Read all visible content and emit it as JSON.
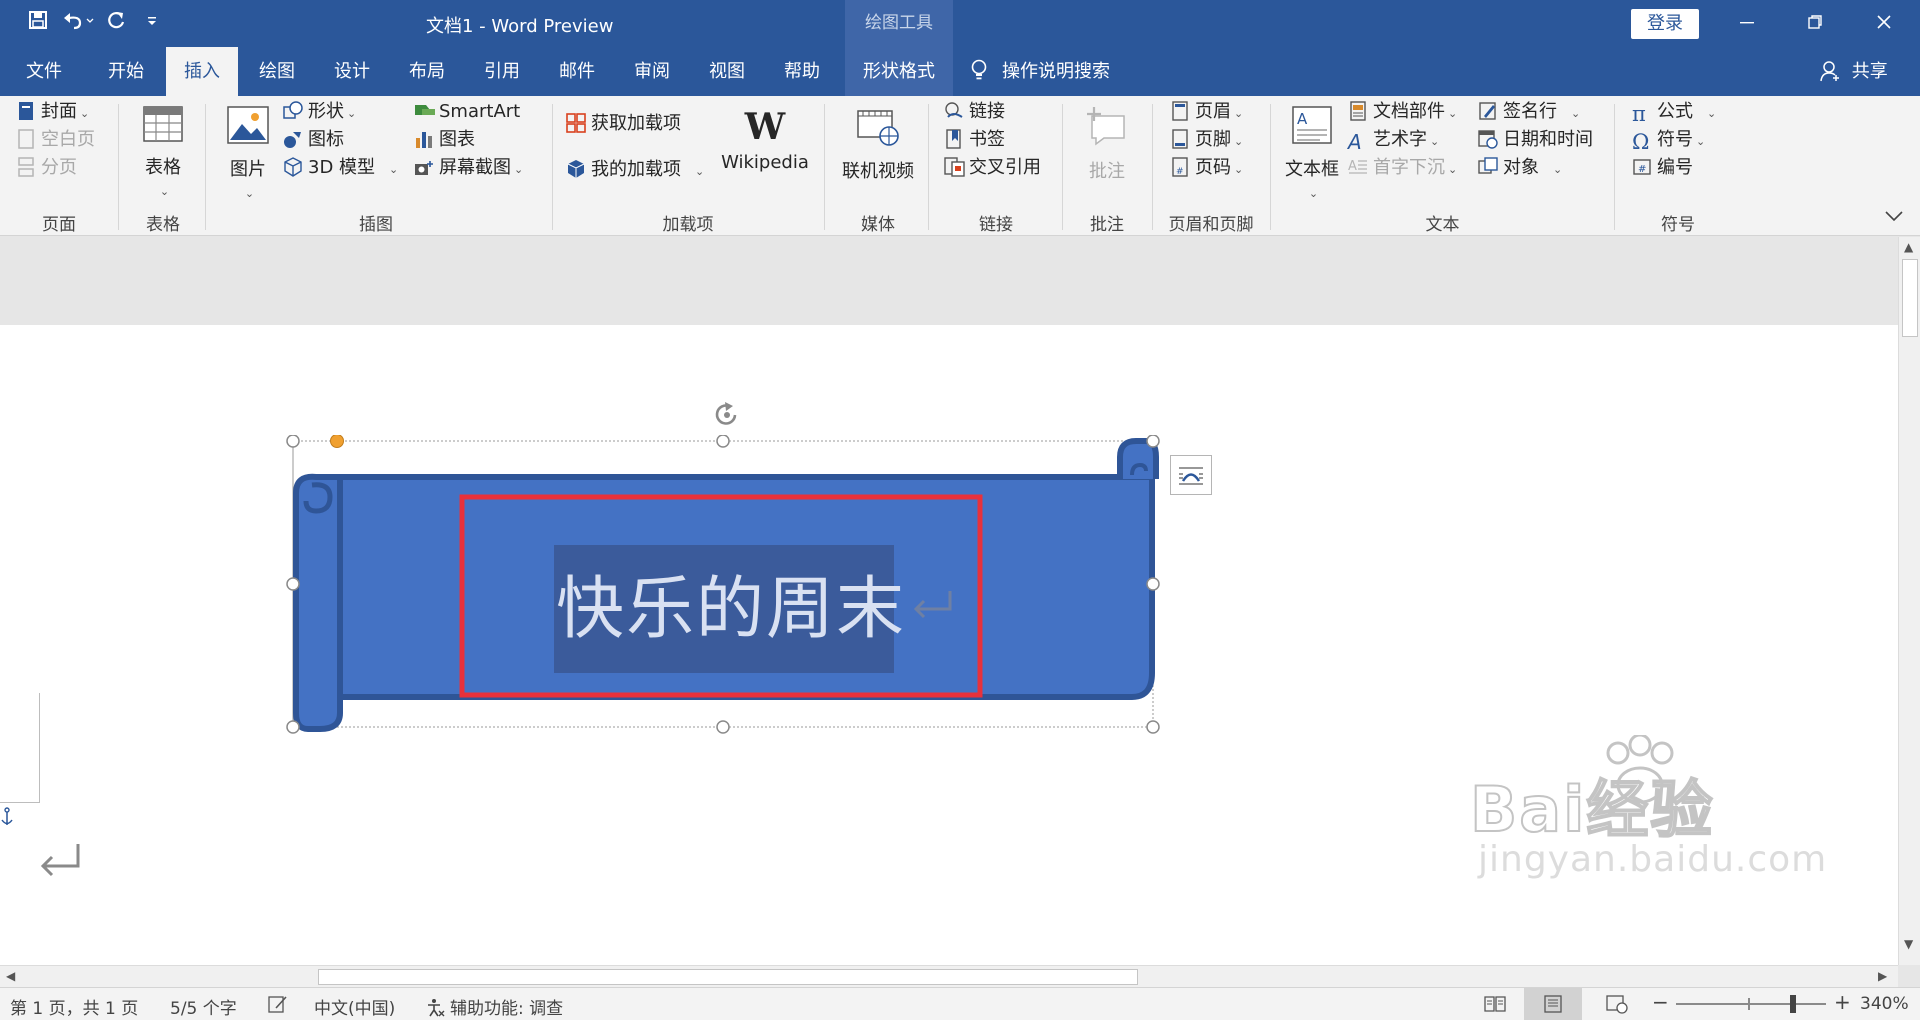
{
  "titlebar": {
    "document_title": "文档1  -  Word Preview",
    "context_tool": "绘图工具",
    "login": "登录",
    "save_icon": "save-icon",
    "undo_icon": "undo-icon",
    "redo_icon": "redo-icon"
  },
  "tabs": [
    {
      "label": "文件"
    },
    {
      "label": "开始"
    },
    {
      "label": "插入"
    },
    {
      "label": "绘图"
    },
    {
      "label": "设计"
    },
    {
      "label": "布局"
    },
    {
      "label": "引用"
    },
    {
      "label": "邮件"
    },
    {
      "label": "审阅"
    },
    {
      "label": "视图"
    },
    {
      "label": "帮助"
    },
    {
      "label": "形状格式"
    }
  ],
  "tell_me": "操作说明搜索",
  "share": "共享",
  "ribbon": {
    "pages": {
      "cover": "封面",
      "blank_page": "空白页",
      "page_break": "分页",
      "label": "页面"
    },
    "tables": {
      "table": "表格",
      "label": "表格"
    },
    "illustrations": {
      "picture": "图片",
      "shapes": "形状",
      "icons": "图标",
      "model3d": "3D 模型",
      "smartart": "SmartArt",
      "chart": "图表",
      "screenshot": "屏幕截图",
      "label": "插图"
    },
    "addins": {
      "get": "获取加载项",
      "my": "我的加载项",
      "wikipedia": "Wikipedia",
      "label": "加载项"
    },
    "media": {
      "online_video": "联机视频",
      "label": "媒体"
    },
    "links": {
      "link": "链接",
      "bookmark": "书签",
      "cross_ref": "交叉引用",
      "label": "链接"
    },
    "comments": {
      "comment": "批注",
      "label": "批注"
    },
    "header_footer": {
      "header": "页眉",
      "footer": "页脚",
      "page_number": "页码",
      "label": "页眉和页脚"
    },
    "text": {
      "textbox": "文本框",
      "quick_parts": "文档部件",
      "wordart": "艺术字",
      "dropcap": "首字下沉",
      "signature": "签名行",
      "datetime": "日期和时间",
      "object": "对象",
      "label": "文本"
    },
    "symbols": {
      "equation": "公式",
      "symbol": "符号",
      "number": "编号",
      "label": "符号"
    }
  },
  "shape": {
    "text": "快乐的周末",
    "fill": "#4472c4",
    "outline": "#2f5597",
    "highlight_box": "#e8313b"
  },
  "statusbar": {
    "page": "第 1 页，共 1 页",
    "words": "5/5 个字",
    "language": "中文(中国)",
    "accessibility": "辅助功能: 调查",
    "zoom": "340%"
  },
  "watermark": {
    "logo": "Bai经验",
    "url": "jingyan.baidu.com"
  }
}
